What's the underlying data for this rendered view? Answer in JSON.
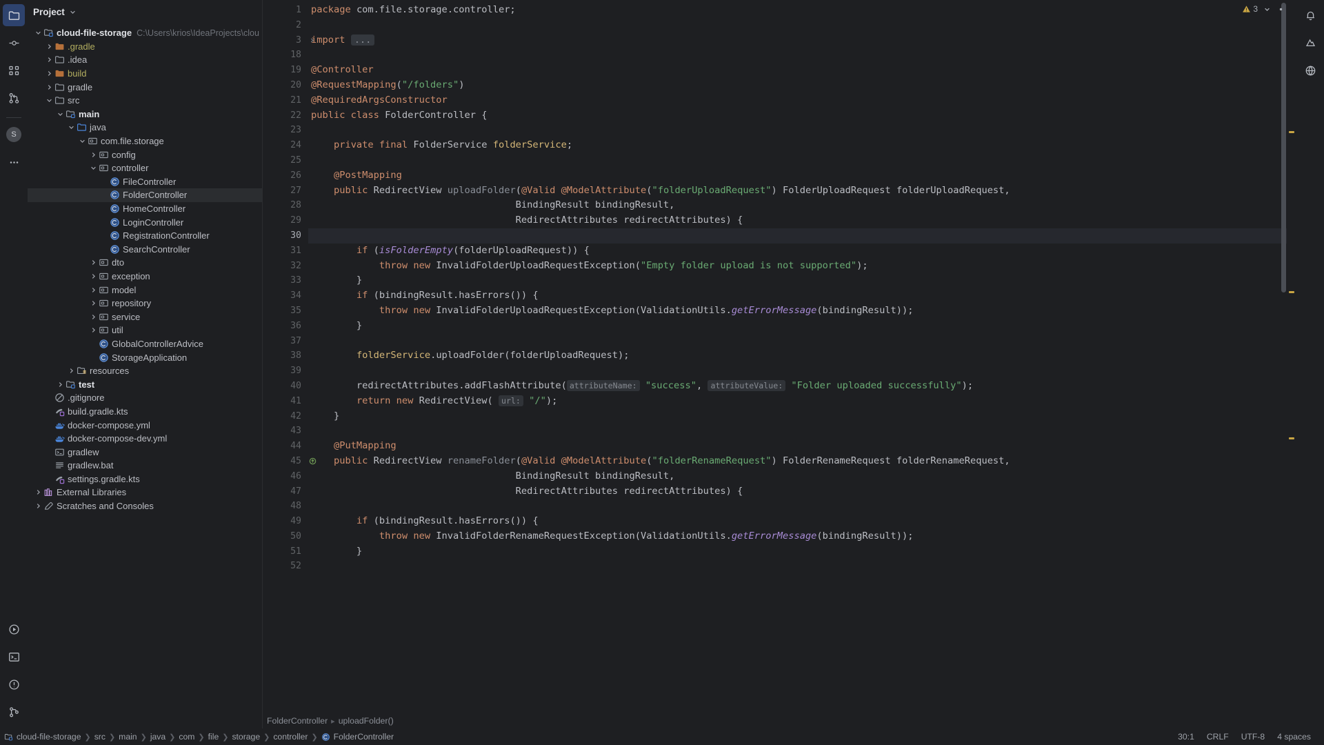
{
  "activity_bar": {
    "items": [
      {
        "name": "project-tool-window",
        "icon": "folder-icon",
        "active": true
      },
      {
        "name": "commit-tool-window",
        "icon": "commit-icon",
        "active": false
      },
      {
        "name": "structure-tool-window",
        "icon": "structure-icon",
        "active": false
      },
      {
        "name": "pull-requests-tool-window",
        "icon": "pull-request-icon",
        "active": false
      }
    ],
    "avatar_initial": "S",
    "more_label": "…",
    "bottom": [
      {
        "name": "run-tool-window",
        "icon": "run-icon"
      },
      {
        "name": "terminal-tool-window",
        "icon": "terminal-icon"
      },
      {
        "name": "problems-tool-window",
        "icon": "problems-icon"
      },
      {
        "name": "version-control-tool-window",
        "icon": "branch-icon"
      }
    ]
  },
  "project_panel": {
    "title": "Project",
    "root": {
      "label": "cloud-file-storage",
      "path": "C:\\Users\\krios\\IdeaProjects\\cloud-file-"
    },
    "tree": [
      {
        "depth": 0,
        "label": "cloud-file-storage",
        "icon": "module-icon",
        "twisty": "open",
        "bold": true,
        "path": "C:\\Users\\krios\\IdeaProjects\\cloud-file-"
      },
      {
        "depth": 1,
        "label": ".gradle",
        "icon": "folder-orange-icon",
        "twisty": "closed",
        "color": "#b3ae60"
      },
      {
        "depth": 1,
        "label": ".idea",
        "icon": "folder-gray-icon",
        "twisty": "closed"
      },
      {
        "depth": 1,
        "label": "build",
        "icon": "folder-orange-icon",
        "twisty": "closed",
        "color": "#b3ae60"
      },
      {
        "depth": 1,
        "label": "gradle",
        "icon": "folder-gray-icon",
        "twisty": "closed"
      },
      {
        "depth": 1,
        "label": "src",
        "icon": "folder-gray-icon",
        "twisty": "open"
      },
      {
        "depth": 2,
        "label": "main",
        "icon": "module-icon",
        "twisty": "open",
        "bold": true
      },
      {
        "depth": 3,
        "label": "java",
        "icon": "folder-source-icon",
        "twisty": "open"
      },
      {
        "depth": 4,
        "label": "com.file.storage",
        "icon": "package-icon",
        "twisty": "open"
      },
      {
        "depth": 5,
        "label": "config",
        "icon": "package-icon",
        "twisty": "closed"
      },
      {
        "depth": 5,
        "label": "controller",
        "icon": "package-icon",
        "twisty": "open"
      },
      {
        "depth": 6,
        "label": "FileController",
        "icon": "class-icon",
        "twisty": "none"
      },
      {
        "depth": 6,
        "label": "FolderController",
        "icon": "class-icon",
        "twisty": "none",
        "selected": true
      },
      {
        "depth": 6,
        "label": "HomeController",
        "icon": "class-icon",
        "twisty": "none"
      },
      {
        "depth": 6,
        "label": "LoginController",
        "icon": "class-icon",
        "twisty": "none"
      },
      {
        "depth": 6,
        "label": "RegistrationController",
        "icon": "class-icon",
        "twisty": "none"
      },
      {
        "depth": 6,
        "label": "SearchController",
        "icon": "class-icon",
        "twisty": "none"
      },
      {
        "depth": 5,
        "label": "dto",
        "icon": "package-icon",
        "twisty": "closed"
      },
      {
        "depth": 5,
        "label": "exception",
        "icon": "package-icon",
        "twisty": "closed"
      },
      {
        "depth": 5,
        "label": "model",
        "icon": "package-icon",
        "twisty": "closed"
      },
      {
        "depth": 5,
        "label": "repository",
        "icon": "package-icon",
        "twisty": "closed"
      },
      {
        "depth": 5,
        "label": "service",
        "icon": "package-icon",
        "twisty": "closed"
      },
      {
        "depth": 5,
        "label": "util",
        "icon": "package-icon",
        "twisty": "closed"
      },
      {
        "depth": 5,
        "label": "GlobalControllerAdvice",
        "icon": "class-icon",
        "twisty": "none"
      },
      {
        "depth": 5,
        "label": "StorageApplication",
        "icon": "class-icon",
        "twisty": "none"
      },
      {
        "depth": 3,
        "label": "resources",
        "icon": "folder-resources-icon",
        "twisty": "closed"
      },
      {
        "depth": 2,
        "label": "test",
        "icon": "module-icon",
        "twisty": "closed",
        "bold": true
      },
      {
        "depth": 1,
        "label": ".gitignore",
        "icon": "gitignore-icon",
        "twisty": "none"
      },
      {
        "depth": 1,
        "label": "build.gradle.kts",
        "icon": "gradle-kts-icon",
        "twisty": "none"
      },
      {
        "depth": 1,
        "label": "docker-compose.yml",
        "icon": "docker-icon",
        "twisty": "none"
      },
      {
        "depth": 1,
        "label": "docker-compose-dev.yml",
        "icon": "docker-icon",
        "twisty": "none"
      },
      {
        "depth": 1,
        "label": "gradlew",
        "icon": "script-icon",
        "twisty": "none"
      },
      {
        "depth": 1,
        "label": "gradlew.bat",
        "icon": "text-file-icon",
        "twisty": "none"
      },
      {
        "depth": 1,
        "label": "settings.gradle.kts",
        "icon": "gradle-kts-icon",
        "twisty": "none"
      },
      {
        "depth": 0,
        "label": "External Libraries",
        "icon": "library-icon",
        "twisty": "closed"
      },
      {
        "depth": 0,
        "label": "Scratches and Consoles",
        "icon": "scratches-icon",
        "twisty": "closed"
      }
    ]
  },
  "editor": {
    "warning_count": "3",
    "caret_line_number": 30,
    "lines": [
      {
        "n": "1",
        "fold": "none",
        "tokens": [
          {
            "t": "package ",
            "c": "kw"
          },
          {
            "t": "com.file.storage.controller;",
            "c": "pln"
          }
        ]
      },
      {
        "n": "2",
        "fold": "none",
        "tokens": []
      },
      {
        "n": "3",
        "fold": "closed",
        "tokens": [
          {
            "t": "import ",
            "c": "kw"
          },
          {
            "t": "...",
            "c": "foldbox"
          }
        ]
      },
      {
        "n": "18",
        "fold": "none",
        "tokens": []
      },
      {
        "n": "19",
        "fold": "none",
        "tokens": [
          {
            "t": "@Controller",
            "c": "ann2"
          }
        ]
      },
      {
        "n": "20",
        "fold": "none",
        "tokens": [
          {
            "t": "@RequestMapping",
            "c": "ann2"
          },
          {
            "t": "(",
            "c": "pln"
          },
          {
            "t": "\"/folders\"",
            "c": "str"
          },
          {
            "t": ")",
            "c": "pln"
          }
        ]
      },
      {
        "n": "21",
        "fold": "none",
        "tokens": [
          {
            "t": "@RequiredArgsConstructor",
            "c": "ann2"
          }
        ]
      },
      {
        "n": "22",
        "fold": "none",
        "tokens": [
          {
            "t": "public class ",
            "c": "kw"
          },
          {
            "t": "FolderController {",
            "c": "pln"
          }
        ]
      },
      {
        "n": "23",
        "fold": "none",
        "tokens": []
      },
      {
        "n": "24",
        "fold": "none",
        "tokens": [
          {
            "t": "    ",
            "c": "pln"
          },
          {
            "t": "private final ",
            "c": "kw"
          },
          {
            "t": "FolderService ",
            "c": "pln"
          },
          {
            "t": "folderService",
            "c": "fldo"
          },
          {
            "t": ";",
            "c": "pln"
          }
        ]
      },
      {
        "n": "25",
        "fold": "none",
        "tokens": []
      },
      {
        "n": "26",
        "fold": "none",
        "tokens": [
          {
            "t": "    ",
            "c": "pln"
          },
          {
            "t": "@PostMapping",
            "c": "ann2"
          }
        ]
      },
      {
        "n": "27",
        "fold": "none",
        "tokens": [
          {
            "t": "    ",
            "c": "pln"
          },
          {
            "t": "public ",
            "c": "kw"
          },
          {
            "t": "RedirectView ",
            "c": "pln"
          },
          {
            "t": "uploadFolder",
            "c": "mth"
          },
          {
            "t": "(",
            "c": "pln"
          },
          {
            "t": "@Valid @ModelAttribute",
            "c": "ann2"
          },
          {
            "t": "(",
            "c": "pln"
          },
          {
            "t": "\"folderUploadRequest\"",
            "c": "str"
          },
          {
            "t": ") FolderUploadRequest folderUploadRequest,",
            "c": "pln"
          }
        ]
      },
      {
        "n": "28",
        "fold": "none",
        "tokens": [
          {
            "t": "                                    BindingResult bindingResult,",
            "c": "pln"
          }
        ]
      },
      {
        "n": "29",
        "fold": "none",
        "tokens": [
          {
            "t": "                                    RedirectAttributes redirectAttributes) {",
            "c": "pln"
          }
        ]
      },
      {
        "n": "30",
        "fold": "none",
        "highlight": true,
        "tokens": []
      },
      {
        "n": "31",
        "fold": "none",
        "tokens": [
          {
            "t": "        ",
            "c": "pln"
          },
          {
            "t": "if ",
            "c": "kw"
          },
          {
            "t": "(",
            "c": "pln"
          },
          {
            "t": "isFolderEmpty",
            "c": "stat"
          },
          {
            "t": "(folderUploadRequest)) {",
            "c": "pln"
          }
        ]
      },
      {
        "n": "32",
        "fold": "none",
        "tokens": [
          {
            "t": "            ",
            "c": "pln"
          },
          {
            "t": "throw new ",
            "c": "kw"
          },
          {
            "t": "InvalidFolderUploadRequestException(",
            "c": "pln"
          },
          {
            "t": "\"Empty folder upload is not supported\"",
            "c": "str"
          },
          {
            "t": ");",
            "c": "pln"
          }
        ]
      },
      {
        "n": "33",
        "fold": "none",
        "tokens": [
          {
            "t": "        }",
            "c": "pln"
          }
        ]
      },
      {
        "n": "34",
        "fold": "none",
        "tokens": [
          {
            "t": "        ",
            "c": "pln"
          },
          {
            "t": "if ",
            "c": "kw"
          },
          {
            "t": "(bindingResult.hasErrors()) {",
            "c": "pln"
          }
        ]
      },
      {
        "n": "35",
        "fold": "none",
        "tokens": [
          {
            "t": "            ",
            "c": "pln"
          },
          {
            "t": "throw new ",
            "c": "kw"
          },
          {
            "t": "InvalidFolderUploadRequestException(ValidationUtils.",
            "c": "pln"
          },
          {
            "t": "getErrorMessage",
            "c": "stat"
          },
          {
            "t": "(bindingResult));",
            "c": "pln"
          }
        ]
      },
      {
        "n": "36",
        "fold": "none",
        "tokens": [
          {
            "t": "        }",
            "c": "pln"
          }
        ]
      },
      {
        "n": "37",
        "fold": "none",
        "tokens": []
      },
      {
        "n": "38",
        "fold": "none",
        "tokens": [
          {
            "t": "        ",
            "c": "pln"
          },
          {
            "t": "folderService",
            "c": "fldo"
          },
          {
            "t": ".uploadFolder(folderUploadRequest);",
            "c": "pln"
          }
        ]
      },
      {
        "n": "39",
        "fold": "none",
        "tokens": []
      },
      {
        "n": "40",
        "fold": "none",
        "tokens": [
          {
            "t": "        redirectAttributes.addFlashAttribute(",
            "c": "pln"
          },
          {
            "t": "attributeName:",
            "c": "hint"
          },
          {
            "t": " ",
            "c": "pln"
          },
          {
            "t": "\"success\"",
            "c": "str"
          },
          {
            "t": ", ",
            "c": "pln"
          },
          {
            "t": "attributeValue:",
            "c": "hint"
          },
          {
            "t": " ",
            "c": "pln"
          },
          {
            "t": "\"Folder uploaded successfully\"",
            "c": "str"
          },
          {
            "t": ");",
            "c": "pln"
          }
        ]
      },
      {
        "n": "41",
        "fold": "none",
        "tokens": [
          {
            "t": "        ",
            "c": "pln"
          },
          {
            "t": "return new ",
            "c": "kw"
          },
          {
            "t": "RedirectView( ",
            "c": "pln"
          },
          {
            "t": "url:",
            "c": "hint"
          },
          {
            "t": " ",
            "c": "pln"
          },
          {
            "t": "\"/\"",
            "c": "str"
          },
          {
            "t": ");",
            "c": "pln"
          }
        ]
      },
      {
        "n": "42",
        "fold": "none",
        "tokens": [
          {
            "t": "    }",
            "c": "pln"
          }
        ]
      },
      {
        "n": "43",
        "fold": "none",
        "tokens": []
      },
      {
        "n": "44",
        "fold": "none",
        "tokens": [
          {
            "t": "    ",
            "c": "pln"
          },
          {
            "t": "@PutMapping",
            "c": "ann2"
          }
        ]
      },
      {
        "n": "45",
        "fold": "none",
        "gutter_icon": "override-icon",
        "tokens": [
          {
            "t": "    ",
            "c": "pln"
          },
          {
            "t": "public ",
            "c": "kw"
          },
          {
            "t": "RedirectView ",
            "c": "pln"
          },
          {
            "t": "renameFolder",
            "c": "mth"
          },
          {
            "t": "(",
            "c": "pln"
          },
          {
            "t": "@Valid @ModelAttribute",
            "c": "ann2"
          },
          {
            "t": "(",
            "c": "pln"
          },
          {
            "t": "\"folderRenameRequest\"",
            "c": "str"
          },
          {
            "t": ") FolderRenameRequest folderRenameRequest,",
            "c": "pln"
          }
        ]
      },
      {
        "n": "46",
        "fold": "none",
        "tokens": [
          {
            "t": "                                    BindingResult bindingResult,",
            "c": "pln"
          }
        ]
      },
      {
        "n": "47",
        "fold": "none",
        "tokens": [
          {
            "t": "                                    RedirectAttributes redirectAttributes) {",
            "c": "pln"
          }
        ]
      },
      {
        "n": "48",
        "fold": "none",
        "tokens": []
      },
      {
        "n": "49",
        "fold": "none",
        "tokens": [
          {
            "t": "        ",
            "c": "pln"
          },
          {
            "t": "if ",
            "c": "kw"
          },
          {
            "t": "(bindingResult.hasErrors()) {",
            "c": "pln"
          }
        ]
      },
      {
        "n": "50",
        "fold": "none",
        "tokens": [
          {
            "t": "            ",
            "c": "pln"
          },
          {
            "t": "throw new ",
            "c": "kw"
          },
          {
            "t": "InvalidFolderRenameRequestException(ValidationUtils.",
            "c": "stat_pln"
          },
          {
            "t": "getErrorMessage",
            "c": "stat"
          },
          {
            "t": "(bindingResult));",
            "c": "pln"
          }
        ]
      },
      {
        "n": "51",
        "fold": "none",
        "tokens": [
          {
            "t": "        }",
            "c": "pln"
          }
        ]
      },
      {
        "n": "52",
        "fold": "none",
        "tokens": []
      }
    ],
    "breadcrumbs": [
      {
        "label": "FolderController"
      },
      {
        "label": "uploadFolder()"
      }
    ]
  },
  "status_bar": {
    "path_crumbs": [
      "cloud-file-storage",
      "src",
      "main",
      "java",
      "com",
      "file",
      "storage",
      "controller"
    ],
    "file_name": "FolderController",
    "caret_position": "30:1",
    "line_separator": "CRLF",
    "encoding": "UTF-8",
    "indent": "4 spaces"
  }
}
